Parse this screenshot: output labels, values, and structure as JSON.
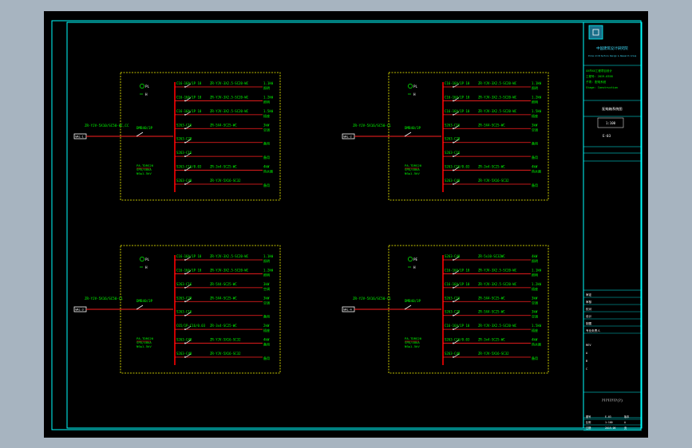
{
  "colors": {
    "background": "#a7b4c0",
    "sheet": "#000000",
    "frame": "#00ffff",
    "panel_border": "#ffff00",
    "busbar": "#ff0000",
    "wire": "#ff2020",
    "text": "#00ff00",
    "white": "#ffffff"
  },
  "panels": [
    {
      "incoming_cable": "ZR-YJV-5X10/SC50-WC,CC",
      "incoming_breaker": "DMB40/3P",
      "source_tag": "WAL-1",
      "indicator_pl": "PL",
      "indicator_h": "H",
      "spd": [
        "PA-TDRS20",
        "SPD/40kA",
        "NS≤1.5kV"
      ],
      "circuits": [
        {
          "breaker": "C16-16A/1P 10",
          "cable": "ZR-YJV-3X2.5-SC20-WC",
          "load": "1.1kW",
          "tag": "照明"
        },
        {
          "breaker": "C16-16A/1P 10",
          "cable": "ZR-YJV-3X2.5-SC20-WC",
          "load": "1.2kW",
          "tag": "照明"
        },
        {
          "breaker": "C16-16A/1P 10",
          "cable": "ZR-YJV-3X2.5-SC20-WC",
          "load": "1.5kW",
          "tag": "插座"
        },
        {
          "breaker": "S263-C16",
          "cable": "ZR-5X4-SC25-WC",
          "load": "3kW",
          "tag": "空调"
        },
        {
          "breaker": "S263-C20",
          "cable": "",
          "load": "",
          "tag": "备用"
        },
        {
          "breaker": "S263-C16",
          "cable": "",
          "load": "",
          "tag": "备用"
        },
        {
          "breaker": "S263-C16/0.03",
          "cable": "ZR-3x4-SC25-WC",
          "load": "4kW",
          "tag": "热水器"
        },
        {
          "breaker": "S263-C40",
          "cable": "ZR-YJV-5X16-SC32",
          "load": "",
          "tag": "备用"
        }
      ]
    },
    {
      "incoming_cable": "ZR-YJV-5X16/SC50-C1",
      "incoming_breaker": "DMB40/3P",
      "source_tag": "WAL-2",
      "indicator_pl": "PL",
      "indicator_h": "H",
      "spd": [
        "PA-TDRS20",
        "SPD/40kA",
        "NS≤1.5kV"
      ],
      "circuits": [
        {
          "breaker": "C16-16A/1P 10",
          "cable": "ZR-YJV-3X2.5-SC20-WC",
          "load": "1.1kW",
          "tag": "照明"
        },
        {
          "breaker": "C16-16A/1P 10",
          "cable": "ZR-YJV-3X2.5-SC20-WC",
          "load": "1.2kW",
          "tag": "照明"
        },
        {
          "breaker": "C16-16A/1P 10",
          "cable": "ZR-YJV-3X2.5-SC20-WC",
          "load": "1.5kW",
          "tag": "插座"
        },
        {
          "breaker": "S263-C16",
          "cable": "ZR-5X4-SC25-WC",
          "load": "3kW",
          "tag": "空调"
        },
        {
          "breaker": "S263-C20",
          "cable": "",
          "load": "",
          "tag": "备用"
        },
        {
          "breaker": "S263-C16",
          "cable": "",
          "load": "",
          "tag": "备用"
        },
        {
          "breaker": "S263-C16/0.03",
          "cable": "ZR-3x4-SC25-WC",
          "load": "4kW",
          "tag": "热水器"
        },
        {
          "breaker": "S263-C40",
          "cable": "ZR-YJV-5X16-SC32",
          "load": "",
          "tag": "备用"
        }
      ]
    },
    {
      "incoming_cable": "ZR-YJV-5X16/SC50-C1",
      "incoming_breaker": "DMB40/3P",
      "source_tag": "WAL-3",
      "indicator_pl": "PL",
      "indicator_h": "H",
      "spd": [
        "PA-TDRS20",
        "SPD/40kA",
        "NS≤1.5kV"
      ],
      "circuits": [
        {
          "breaker": "C16-16A/1P 10",
          "cable": "ZR-YJV-3X2.5-SC20-WC",
          "load": "1.1kW",
          "tag": "照明"
        },
        {
          "breaker": "C16-16A/1P 10",
          "cable": "ZR-YJV-3X2.5-SC20-WC",
          "load": "1.2kW",
          "tag": "照明"
        },
        {
          "breaker": "S263-C16",
          "cable": "ZR-5X4-SC25-WC",
          "load": "3kW",
          "tag": "空调"
        },
        {
          "breaker": "S263-C20",
          "cable": "ZR-5X4-SC25-WC",
          "load": "3kW",
          "tag": "空调"
        },
        {
          "breaker": "S263-C16",
          "cable": "",
          "load": "",
          "tag": "备用"
        },
        {
          "breaker": "C65/1P-C16/0.03",
          "cable": "ZR-3x4-SC25-WC",
          "load": "2kW",
          "tag": "插座"
        },
        {
          "breaker": "S263-C40",
          "cable": "ZR-YJV-5X16-SC32",
          "load": "4kW",
          "tag": "备用"
        },
        {
          "breaker": "S263-C40",
          "cable": "ZR-YJV-5X16-SC32",
          "load": "",
          "tag": "备用"
        }
      ]
    },
    {
      "incoming_cable": "ZR-YJV-5X16/SC50-C1",
      "incoming_breaker": "DMB40/3P",
      "source_tag": "WAL-4",
      "indicator_pl": "PE",
      "indicator_h": "H",
      "spd": [
        "PA-TDRS20",
        "SPD/40kA",
        "NS≤1.5kV"
      ],
      "circuits": [
        {
          "breaker": "S263-C40",
          "cable": "ZR-5x10-SC32WC",
          "load": "4kW",
          "tag": "照明"
        },
        {
          "breaker": "C16-16A/1P 10",
          "cable": "ZR-YJV-3X2.5-SC20-WC",
          "load": "1.1kW",
          "tag": "照明"
        },
        {
          "breaker": "C16-16A/1P 10",
          "cable": "ZR-YJV-3X2.5-SC20-WC",
          "load": "1.2kW",
          "tag": "插座"
        },
        {
          "breaker": "S263-C16",
          "cable": "ZR-5X4-SC25-WC",
          "load": "3kW",
          "tag": "空调"
        },
        {
          "breaker": "S263-C20",
          "cable": "ZR-5X4-SC25-WC",
          "load": "3kW",
          "tag": "空调"
        },
        {
          "breaker": "C16-16A/1P 10",
          "cable": "ZR-YJV-3X2.5-SC20-WC",
          "load": "1.5kW",
          "tag": "插座"
        },
        {
          "breaker": "S263-C16/0.03",
          "cable": "ZR-3x4-SC25-WC",
          "load": "4kW",
          "tag": "热水器"
        },
        {
          "breaker": "S263-C40",
          "cable": "ZR-YJV-5X16-SC32",
          "load": "",
          "tag": "备用"
        }
      ]
    }
  ],
  "title_block": {
    "institute": "中国建筑设计研究院",
    "institute_sub": "China Architecture Design & Research Group",
    "project_lines": [
      "XX市XX工程项目设计",
      "工程号: 2019-0358",
      "子项: 配电系统",
      "Stage: Construction"
    ],
    "drawing_title": "配电箱系统图",
    "scale": "1:100",
    "sheet_no": "E-03",
    "stamp_lines": [
      "审定",
      "审核",
      "校对",
      "设计",
      "制图",
      "专业负责人"
    ],
    "revision_rows": [
      "REV",
      "A",
      "B",
      "C"
    ],
    "bottom_code": "????????(?)",
    "bottom_rows": [
      [
        "图号",
        "E-03",
        "版本"
      ],
      [
        "比例",
        "1:100",
        "A"
      ],
      [
        "日期",
        "2019.06",
        "页"
      ]
    ]
  }
}
